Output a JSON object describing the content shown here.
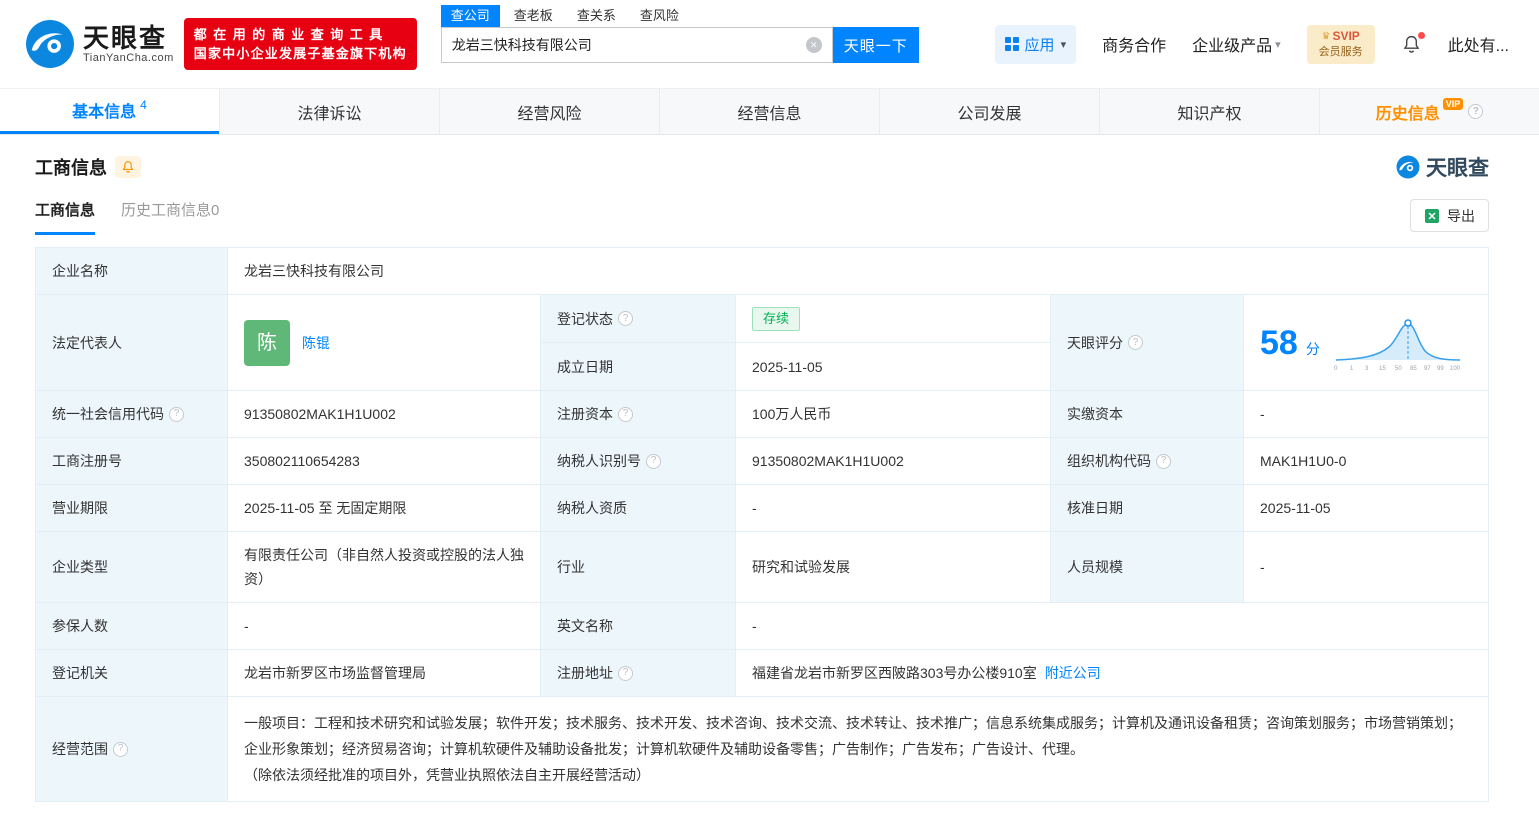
{
  "colors": {
    "accent_blue": "#0084ff",
    "promo_red": "#e60012",
    "vip_orange": "#ff9000",
    "status_green": "#00b152",
    "avatar_green": "#5fb878",
    "label_cell_bg": "#ecf6fb"
  },
  "icons": {
    "help": "?",
    "clear": "✕",
    "caret": "▾",
    "crown": "♛"
  },
  "header": {
    "brand": "天眼查",
    "brand_domain": "TianYanCha.com",
    "promo_line1": "都在用的商业查询工具",
    "promo_line2": "国家中小企业发展子基金旗下机构",
    "search_tabs": [
      {
        "label": "查公司"
      },
      {
        "label": "查老板"
      },
      {
        "label": "查关系"
      },
      {
        "label": "查风险"
      }
    ],
    "search_value": "龙岩三快科技有限公司",
    "search_button": "天眼一下",
    "nav_app": "应用",
    "nav_cooperation": "商务合作",
    "nav_enterprise": "企业级产品",
    "vip_line1": "SVIP",
    "vip_line2": "会员服务",
    "nav_more": "此处有..."
  },
  "nav_tabs": [
    {
      "label": "基本信息",
      "badge": "4"
    },
    {
      "label": "法律诉讼"
    },
    {
      "label": "经营风险"
    },
    {
      "label": "经营信息"
    },
    {
      "label": "公司发展"
    },
    {
      "label": "知识产权"
    },
    {
      "label": "历史信息",
      "vip": "VIP"
    }
  ],
  "section": {
    "title": "工商信息",
    "subtab_current": "工商信息",
    "subtab_history": "历史工商信息0",
    "export_label": "导出",
    "brand_watermark": "天眼查"
  },
  "fields": {
    "company_name_label": "企业名称",
    "company_name": "龙岩三快科技有限公司",
    "legal_rep_label": "法定代表人",
    "legal_rep_avatar": "陈",
    "legal_rep_name": "陈锟",
    "reg_status_label": "登记状态",
    "reg_status": "存续",
    "establish_date_label": "成立日期",
    "establish_date": "2025-11-05",
    "score_label": "天眼评分",
    "credit_code_label": "统一社会信用代码",
    "credit_code": "91350802MAK1H1U002",
    "reg_capital_label": "注册资本",
    "reg_capital": "100万人民币",
    "paid_capital_label": "实缴资本",
    "paid_capital": "-",
    "reg_number_label": "工商注册号",
    "reg_number": "350802110654283",
    "taxpayer_id_label": "纳税人识别号",
    "taxpayer_id": "91350802MAK1H1U002",
    "org_code_label": "组织机构代码",
    "org_code": "MAK1H1U0-0",
    "business_term_label": "营业期限",
    "business_term": "2025-11-05 至 无固定期限",
    "taxpayer_quality_label": "纳税人资质",
    "taxpayer_quality": "-",
    "approval_date_label": "核准日期",
    "approval_date": "2025-11-05",
    "company_type_label": "企业类型",
    "company_type": "有限责任公司（非自然人投资或控股的法人独资）",
    "industry_label": "行业",
    "industry": "研究和试验发展",
    "staff_size_label": "人员规模",
    "staff_size": "-",
    "insured_count_label": "参保人数",
    "insured_count": "-",
    "english_name_label": "英文名称",
    "english_name": "-",
    "reg_authority_label": "登记机关",
    "reg_authority": "龙岩市新罗区市场监督管理局",
    "reg_address_label": "注册地址",
    "reg_address": "福建省龙岩市新罗区西陂路303号办公楼910室",
    "nearby_link": "附近公司",
    "business_scope_label": "经营范围",
    "business_scope": "一般项目：工程和技术研究和试验发展；软件开发；技术服务、技术开发、技术咨询、技术交流、技术转让、技术推广；信息系统集成服务；计算机及通讯设备租赁；咨询策划服务；市场营销策划；企业形象策划；经济贸易咨询；计算机软硬件及辅助设备批发；计算机软硬件及辅助设备零售；广告制作；广告发布；广告设计、代理。",
    "business_scope_note": "（除依法须经批准的项目外，凭营业执照依法自主开展经营活动）"
  },
  "chart_data": {
    "type": "area",
    "title": "天眼评分分布曲线",
    "score": "58",
    "unit": "分",
    "x_labels": [
      "0",
      "1",
      "3",
      "15",
      "50",
      "85",
      "97",
      "99",
      "100"
    ],
    "marker_at_label": "58"
  }
}
